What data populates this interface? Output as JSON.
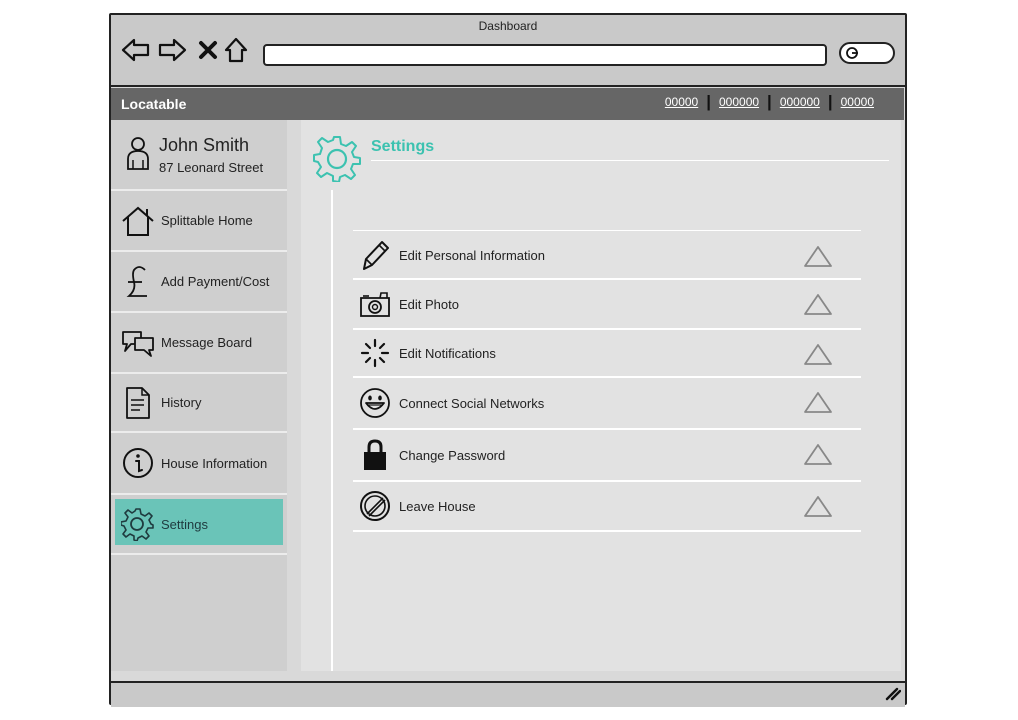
{
  "window": {
    "title": "Dashboard"
  },
  "appbar": {
    "brand": "Locatable",
    "links": [
      "00000",
      "000000",
      "000000",
      "00000"
    ]
  },
  "sidebar": {
    "user": {
      "name": "John Smith",
      "address": "87 Leonard Street",
      "icon": "user-icon"
    },
    "items": [
      {
        "label": "Splittable Home",
        "icon": "home-icon"
      },
      {
        "label": "Add Payment/Cost",
        "icon": "pound-icon"
      },
      {
        "label": "Message Board",
        "icon": "chat-bubbles-icon"
      },
      {
        "label": "History",
        "icon": "document-icon"
      },
      {
        "label": "House Information",
        "icon": "info-icon"
      },
      {
        "label": "Settings",
        "icon": "gear-icon",
        "active": true
      }
    ]
  },
  "main": {
    "title": "Settings",
    "accent_color": "#3cc2b0",
    "rows": [
      {
        "label": "Edit Personal Information",
        "icon": "pencil-icon"
      },
      {
        "label": "Edit Photo",
        "icon": "camera-icon"
      },
      {
        "label": "Edit Notifications",
        "icon": "spinner-icon"
      },
      {
        "label": "Connect Social Networks",
        "icon": "smiley-icon"
      },
      {
        "label": "Change Password",
        "icon": "lock-icon"
      },
      {
        "label": "Leave House",
        "icon": "block-icon"
      }
    ]
  },
  "colors": {
    "sidebar_active": "#6ac4b8",
    "appbar": "#666666"
  }
}
